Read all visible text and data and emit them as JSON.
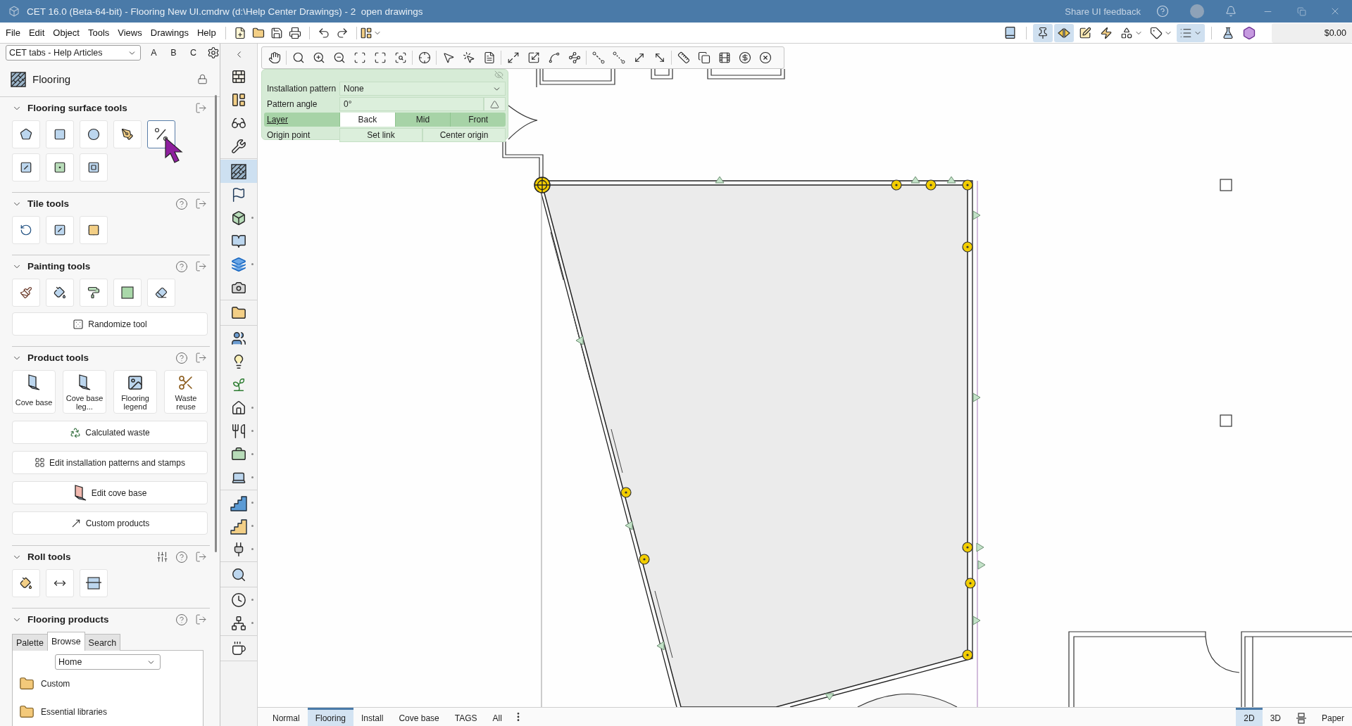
{
  "window": {
    "title": "CET 16.0 (Beta-64-bit) - Flooring New UI.cmdrw (d:\\Help Center Drawings) - 2  open drawings",
    "feedback": "Share UI feedback"
  },
  "menu": [
    "File",
    "Edit",
    "Object",
    "Tools",
    "Views",
    "Drawings",
    "Help"
  ],
  "right_toolbar": [
    {
      "on": false,
      "dropdown": false
    },
    {
      "on": true,
      "dropdown": false
    },
    {
      "on": true,
      "dropdown": false
    },
    {
      "on": false,
      "dropdown": false
    },
    {
      "on": false,
      "dropdown": false
    },
    {
      "on": false,
      "dropdown": true
    },
    {
      "on": false,
      "dropdown": true
    },
    {
      "on": true,
      "dropdown": true
    },
    {
      "on": false,
      "dropdown": false
    },
    {
      "on": false,
      "dropdown": false
    }
  ],
  "price": "$0.00",
  "panel": {
    "tab_set": "CET tabs - Help Articles",
    "letters": [
      "A",
      "B",
      "C"
    ],
    "title": "Flooring",
    "sections": [
      {
        "kind": "tools",
        "title": "Flooring surface tools",
        "expanded": true,
        "help": false,
        "settings": false,
        "tools": [
          {
            "selected": false
          },
          {
            "selected": false
          },
          {
            "selected": false
          },
          {
            "selected": false
          },
          {
            "selected": true
          },
          {
            "selected": false
          },
          {
            "selected": false
          },
          {
            "selected": false
          }
        ]
      },
      {
        "kind": "tools",
        "title": "Tile tools",
        "expanded": true,
        "help": true,
        "settings": false,
        "tools": [
          {
            "selected": false
          },
          {
            "selected": false
          },
          {
            "selected": false
          }
        ]
      },
      {
        "kind": "tools",
        "title": "Painting tools",
        "expanded": true,
        "help": true,
        "settings": false,
        "tools": [
          {
            "selected": false
          },
          {
            "selected": false
          },
          {
            "selected": false
          },
          {
            "selected": false
          },
          {
            "selected": false
          }
        ],
        "buttons": [
          "Randomize tool"
        ]
      },
      {
        "kind": "products",
        "title": "Product tools",
        "expanded": true,
        "help": true,
        "settings": false,
        "cards": [
          "Cove base",
          "Cove base leg...",
          "Flooring legend",
          "Waste reuse"
        ],
        "buttons": [
          "Calculated waste",
          "Edit installation patterns and stamps",
          "Edit cove base",
          "Custom products"
        ]
      },
      {
        "kind": "tools",
        "title": "Roll tools",
        "expanded": true,
        "help": true,
        "settings": true,
        "tools": [
          {
            "selected": false
          },
          {
            "selected": false
          },
          {
            "selected": false
          }
        ]
      },
      {
        "kind": "browser",
        "title": "Flooring products",
        "expanded": true,
        "help": true,
        "settings": false,
        "tabs": [
          {
            "label": "Palette",
            "selected": false
          },
          {
            "label": "Browse",
            "selected": true
          },
          {
            "label": "Search",
            "selected": false
          }
        ],
        "location": "Home",
        "folders": [
          "Custom",
          "Essential libraries"
        ]
      }
    ]
  },
  "side_strip": [
    [
      {
        "selected": false,
        "menu": false
      },
      {
        "selected": false,
        "menu": false
      },
      {
        "selected": false,
        "menu": false
      },
      {
        "selected": false,
        "menu": false
      }
    ],
    [
      {
        "selected": true,
        "menu": false
      },
      {
        "selected": false,
        "menu": false
      },
      {
        "selected": false,
        "menu": true
      },
      {
        "selected": false,
        "menu": false
      },
      {
        "selected": false,
        "menu": true
      },
      {
        "selected": false,
        "menu": false
      }
    ],
    [
      {
        "selected": false,
        "menu": false
      }
    ],
    [
      {
        "selected": false,
        "menu": false
      },
      {
        "selected": false,
        "menu": false
      },
      {
        "selected": false,
        "menu": false
      },
      {
        "selected": false,
        "menu": true
      },
      {
        "selected": false,
        "menu": true
      },
      {
        "selected": false,
        "menu": true
      },
      {
        "selected": false,
        "menu": true
      }
    ],
    [
      {
        "selected": false,
        "menu": true
      },
      {
        "selected": false,
        "menu": true
      },
      {
        "selected": false,
        "menu": true
      }
    ],
    [
      {
        "selected": false,
        "menu": false
      }
    ],
    [
      {
        "selected": false,
        "menu": true
      },
      {
        "selected": false,
        "menu": true
      }
    ],
    [
      {
        "selected": false,
        "menu": false
      }
    ]
  ],
  "properties": {
    "rows": [
      {
        "kind": "select",
        "label": "Installation pattern",
        "value": "None"
      },
      {
        "kind": "angle",
        "label": "Pattern angle",
        "value": "0°"
      },
      {
        "kind": "segments",
        "label": "Layer",
        "options": [
          {
            "label": "Back",
            "selected": true
          },
          {
            "label": "Mid",
            "selected": false
          },
          {
            "label": "Front",
            "selected": false
          }
        ]
      },
      {
        "kind": "buttons",
        "label": "Origin point",
        "buttons": [
          "Set link",
          "Center origin"
        ]
      }
    ]
  },
  "view_tabs": [
    {
      "label": "Normal",
      "selected": false
    },
    {
      "label": "Flooring",
      "selected": true
    },
    {
      "label": "Install",
      "selected": false
    },
    {
      "label": "Cove base",
      "selected": false
    },
    {
      "label": "TAGS",
      "selected": false
    },
    {
      "label": "All",
      "selected": false
    }
  ],
  "view_modes": [
    {
      "kind": "text",
      "label": "2D",
      "selected": true
    },
    {
      "kind": "text",
      "label": "3D",
      "selected": false
    },
    {
      "kind": "icon",
      "selected": false
    },
    {
      "kind": "text",
      "label": "Paper",
      "selected": false
    }
  ]
}
